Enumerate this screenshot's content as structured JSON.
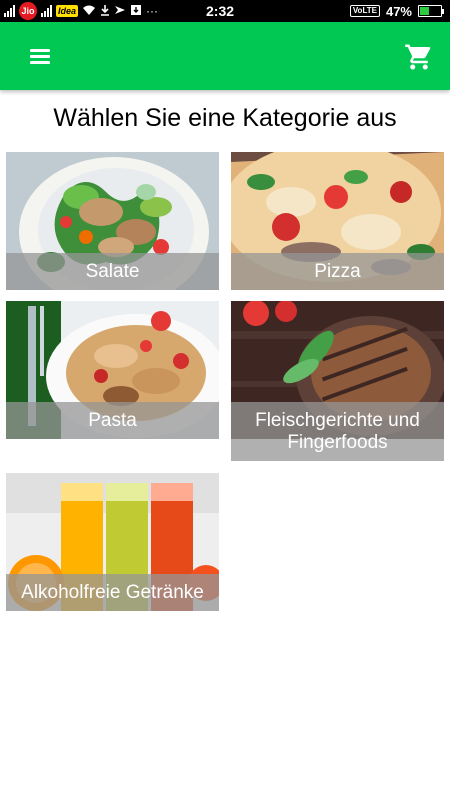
{
  "status_bar": {
    "carrier_1": "Jio",
    "carrier_2": "Idea",
    "time": "2:32",
    "volte": "VoLTE",
    "battery_percent": "47%",
    "battery_level": 0.47
  },
  "app_bar": {
    "color": "#00c853",
    "menu_icon": "hamburger-menu-icon",
    "cart_icon": "shopping-cart-icon"
  },
  "page_title": "Wählen Sie eine Kategorie aus",
  "categories": [
    {
      "label": "Salate"
    },
    {
      "label": "Pizza"
    },
    {
      "label": "Pasta"
    },
    {
      "label": "Fleischgerichte und Fingerfoods"
    },
    {
      "label": "Alkoholfreie Getränke"
    }
  ]
}
